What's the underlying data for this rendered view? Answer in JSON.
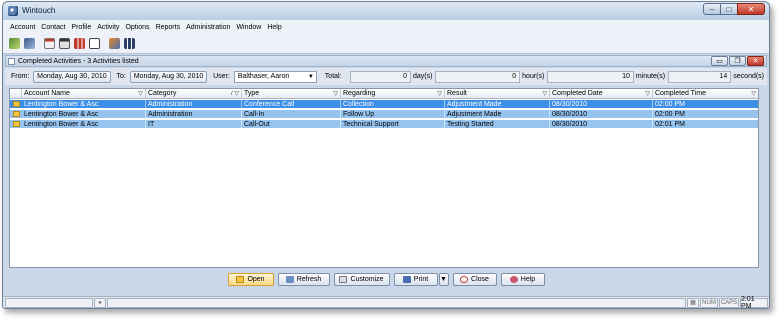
{
  "window": {
    "title": "Wintouch"
  },
  "menu": [
    "Account",
    "Contact",
    "Profile",
    "Activity",
    "Options",
    "Reports",
    "Administration",
    "Window",
    "Help"
  ],
  "toolbar_icons": [
    "address-book-icon",
    "contact-icon",
    "calendar-icon",
    "report-icon",
    "chart-icon",
    "checklist-icon",
    "tools-icon",
    "grid-icon"
  ],
  "document": {
    "title": "Completed Activities - 3 Activities listed"
  },
  "filter": {
    "from_label": "From:",
    "from_value": "Monday, Aug 30, 2010",
    "to_label": "To:",
    "to_value": "Monday, Aug 30, 2010",
    "user_label": "User:",
    "user_value": "Balthaser, Aaron",
    "total_label": "Total:",
    "days_value": "0",
    "days_unit": "day(s)",
    "hours_value": "0",
    "hours_unit": "hour(s)",
    "minutes_value": "10",
    "minutes_unit": "minute(s)",
    "seconds_value": "14",
    "seconds_unit": "second(s)"
  },
  "grid": {
    "columns": [
      "Account Name",
      "Category",
      "Type",
      "Regarding",
      "Result",
      "Completed Date",
      "Completed Time"
    ],
    "rows": [
      [
        "Lentington Bower & Asc",
        "Administration",
        "Conference Call",
        "Collection",
        "Adjustment Made",
        "08/30/2010",
        "02:00 PM"
      ],
      [
        "Lentington Bower & Asc",
        "Administration",
        "Call-In",
        "Follow Up",
        "Adjustment Made",
        "08/30/2010",
        "02:00 PM"
      ],
      [
        "Lentington Bower & Asc",
        "IT",
        "Call-Out",
        "Technical Support",
        "Testing Started",
        "08/30/2010",
        "02:01 PM"
      ]
    ]
  },
  "buttons": {
    "open": "Open",
    "refresh": "Refresh",
    "customize": "Customize",
    "print": "Print",
    "close": "Close",
    "help": "Help"
  },
  "status": {
    "num": "NUM",
    "caps": "CAPS",
    "time": "2:01 PM"
  }
}
